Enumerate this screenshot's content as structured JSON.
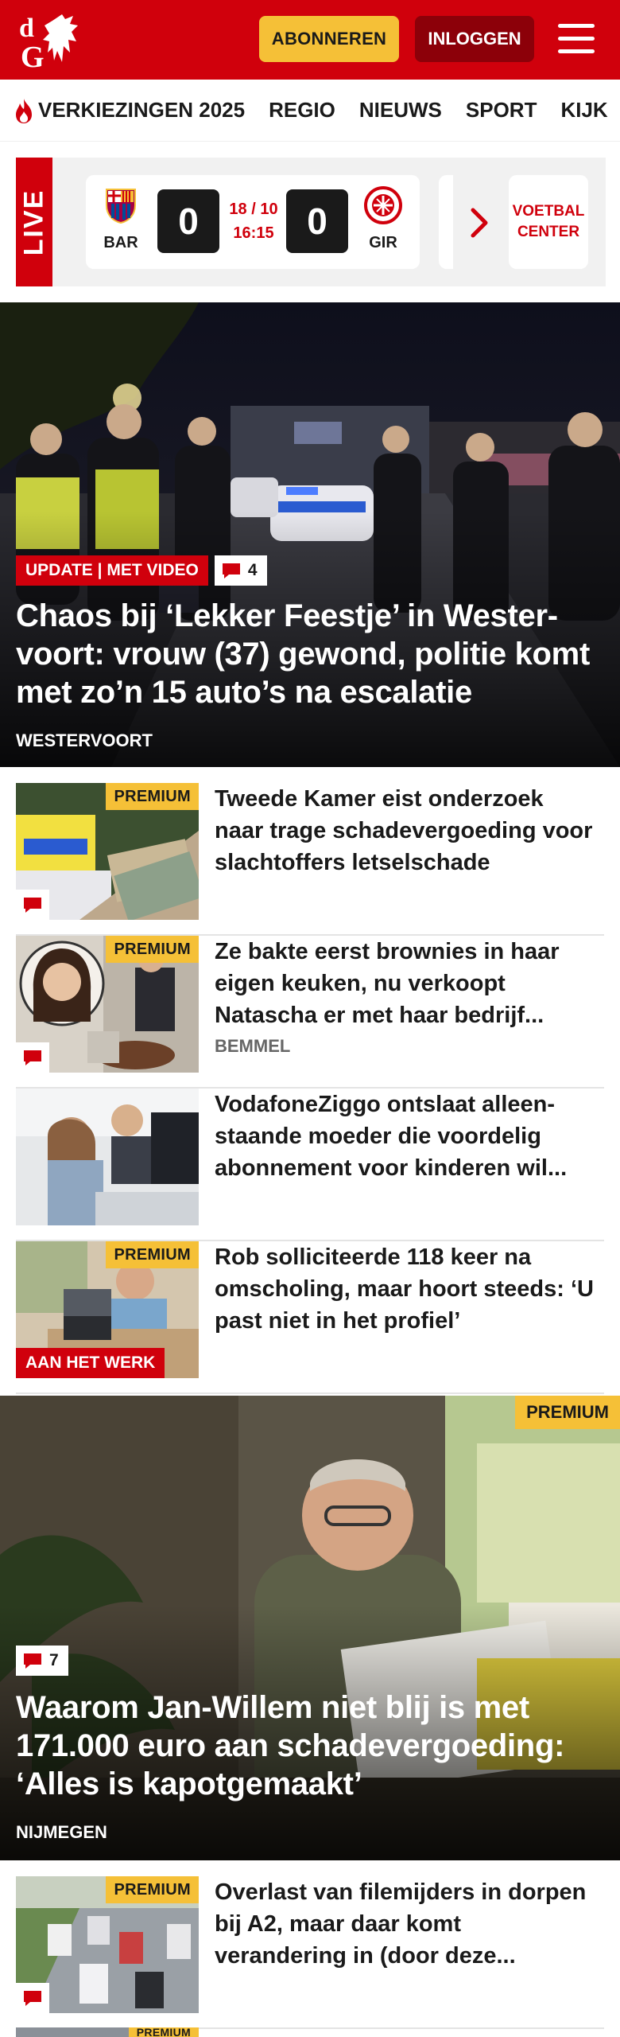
{
  "header": {
    "logo_text": "dG",
    "subscribe_label": "ABONNEREN",
    "login_label": "INLOGGEN",
    "colors": {
      "brand": "#d0000c",
      "accent": "#f5c037",
      "dark_red": "#8c0009"
    }
  },
  "nav": {
    "items": [
      {
        "label": "VERKIEZINGEN 2025",
        "icon": "flame-icon"
      },
      {
        "label": "REGIO"
      },
      {
        "label": "NIEUWS"
      },
      {
        "label": "SPORT"
      },
      {
        "label": "KIJK"
      }
    ]
  },
  "live": {
    "label": "LIVE",
    "match": {
      "home": "BAR",
      "away": "GIR",
      "home_score": "0",
      "away_score": "0",
      "date": "18 / 10",
      "time": "16:15"
    },
    "center_label_1": "VOETBAL",
    "center_label_2": "CENTER"
  },
  "hero1": {
    "tag": "UPDATE | MET VIDEO",
    "comments": "4",
    "title": "Chaos bij ‘Lekker Feestje’ in Wester-voort: vrouw (37) gewond, politie komt met zo’n 15 auto’s na escalatie",
    "location": "WESTERVOORT"
  },
  "list1": [
    {
      "title": "Tweede Kamer eist onderzoek naar trage schadevergoeding voor slachtoffers letselschade",
      "premium": "PREMIUM",
      "location": ""
    },
    {
      "title": "Ze bakte eerst brownies in haar eigen keuken, nu verkoopt Natascha er met haar bedrijf...",
      "premium": "PREMIUM",
      "location": "BEMMEL"
    },
    {
      "title": "VodafoneZiggo ontslaat alleen-staande moeder die voordelig abonnement voor kinderen wil...",
      "premium": "",
      "location": ""
    },
    {
      "title": "Rob solliciteerde 118 keer na omscholing, maar hoort steeds: ‘U past niet in het profiel’",
      "premium": "PREMIUM",
      "tag": "AAN HET WERK",
      "location": ""
    }
  ],
  "hero2": {
    "premium": "PREMIUM",
    "comments": "7",
    "title": "Waarom Jan-Willem niet blij is met 171.000 euro aan schadevergoeding: ‘Alles is kapotgemaakt’",
    "location": "NIJMEGEN"
  },
  "list2": [
    {
      "title": "Overlast van filemijders in dorpen bij A2, maar daar komt verandering in (door deze...",
      "premium": "PREMIUM"
    },
    {
      "title": "",
      "premium": "PREMIUM"
    }
  ]
}
